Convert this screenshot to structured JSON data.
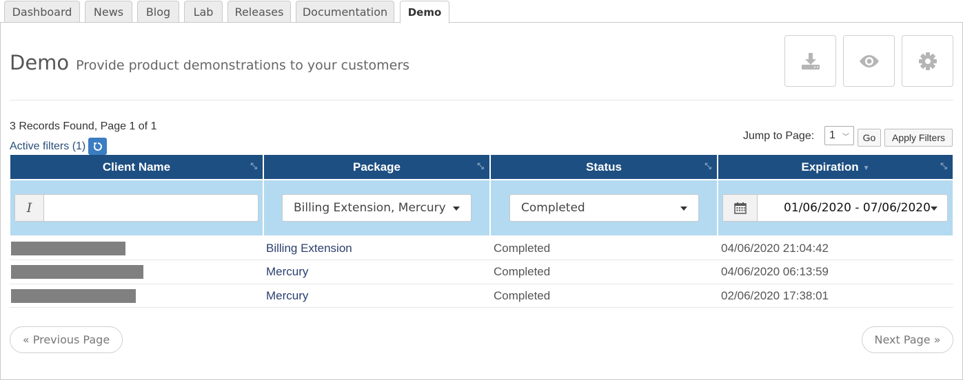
{
  "tabs": [
    {
      "label": "Dashboard"
    },
    {
      "label": "News"
    },
    {
      "label": "Blog"
    },
    {
      "label": "Lab"
    },
    {
      "label": "Releases"
    },
    {
      "label": "Documentation"
    },
    {
      "label": "Demo",
      "active": true
    }
  ],
  "header": {
    "title": "Demo",
    "subtitle": "Provide product demonstrations to your customers",
    "tools": [
      {
        "icon": "download-icon"
      },
      {
        "icon": "eye-icon"
      },
      {
        "icon": "gear-icon"
      }
    ]
  },
  "summary": {
    "records_text": "3 Records Found, Page 1 of 1",
    "active_filters_text": "Active filters (1)",
    "jump_label": "Jump to Page:",
    "page_value": "1",
    "go_label": "Go",
    "apply_label": "Apply Filters"
  },
  "table": {
    "columns": [
      {
        "label": "Client Name"
      },
      {
        "label": "Package"
      },
      {
        "label": "Status"
      },
      {
        "label": "Expiration",
        "sorted": "desc"
      }
    ],
    "filters": {
      "client_name": "",
      "package": "Billing Extension, Mercury",
      "status": "Completed",
      "expiration": "01/06/2020 - 07/06/2020"
    },
    "rows": [
      {
        "package": "Billing Extension",
        "status": "Completed",
        "expiration": "04/06/2020 21:04:42"
      },
      {
        "package": "Mercury",
        "status": "Completed",
        "expiration": "04/06/2020 06:13:59"
      },
      {
        "package": "Mercury",
        "status": "Completed",
        "expiration": "02/06/2020 17:38:01"
      }
    ]
  },
  "pagination": {
    "prev_label": "« Previous Page",
    "next_label": "Next Page »"
  },
  "colors": {
    "header_bg": "#1e4f82",
    "filter_bg": "#b3daf0",
    "accent_button": "#3a7dc3"
  }
}
